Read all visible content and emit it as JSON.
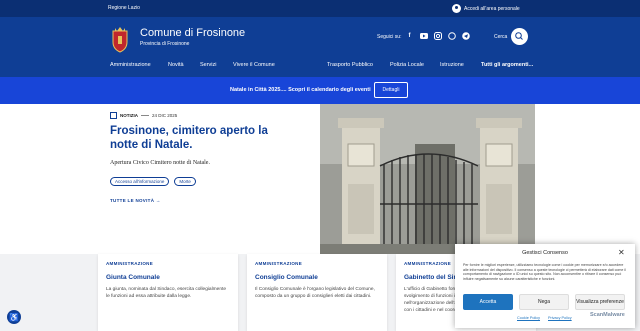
{
  "topbar": {
    "region": "Regione Lazio",
    "login": "Accedi all'area personale"
  },
  "header": {
    "title": "Comune di Frosinone",
    "subtitle": "Provincia di Frosinone",
    "social_label": "Seguici su:",
    "socials": [
      "facebook-icon",
      "youtube-icon",
      "instagram-icon",
      "whatsapp-icon",
      "telegram-icon"
    ],
    "search_label": "Cerca"
  },
  "nav": {
    "items": [
      "Amministrazione",
      "Novità",
      "Servizi",
      "Vivere il Comune"
    ],
    "secondary": [
      "Trasporto Pubblico",
      "Polizia Locale",
      "Istruzione"
    ],
    "all": "Tutti gli argomenti..."
  },
  "banner": {
    "text": "Natale in Città 2025.... Scopri il calendario degli eventi",
    "button": "Dettagli"
  },
  "article": {
    "category": "NOTIZIA",
    "date": "24 DIC 2025",
    "title": "Frosinone, cimitero aperto la notte di Natale.",
    "lede": "Apertura Civico Cimitero notte di Natale.",
    "tags": [
      "Accesso all'informazione",
      "Morte"
    ],
    "all_news": "TUTTE LE NOVITÀ"
  },
  "cards": [
    {
      "kicker": "AMMINISTRAZIONE",
      "title": "Giunta Comunale",
      "desc": "La giunta, nominata dal Sindaco, esercita collegialmente le funzioni ad essa attribuite dalla legge."
    },
    {
      "kicker": "AMMINISTRAZIONE",
      "title": "Consiglio Comunale",
      "desc": "Il Consiglio Comunale è l'organo legislativo del Comune, composto da un gruppo di consiglieri eletti dai cittadini."
    },
    {
      "kicker": "AMMINISTRAZIONE",
      "title": "Gabinetto del Sindaco",
      "desc": "L'ufficio di Gabinetto fornisce supporto al Sindaco nello svolgimento di funzioni istituzionali, coadiuvandolo nell'organizzazione dell'attività della Giunta, nei rapporti con i cittadini e nel coordinamento della Giunta."
    }
  ],
  "consent": {
    "title": "Gestisci Consenso",
    "body": "Per fornire le migliori esperienze, utilizziamo tecnologie come i cookie per memorizzare e/o accedere alle informazioni del dispositivo. Il consenso a queste tecnologie ci permetterà di elaborare dati come il comportamento di navigazione o ID unici su questo sito. Non acconsentire o ritirare il consenso può influire negativamente su alcune caratteristiche e funzioni.",
    "accept": "Accetta",
    "deny": "Nega",
    "prefs": "Visualizza preferenze",
    "cookie_policy": "Cookie Policy",
    "privacy_policy": "Privacy Policy",
    "watermark": "ScanMalware"
  },
  "colors": {
    "primary": "#0f3e95",
    "banner": "#1845d8",
    "topbar": "#0b2f73",
    "accept": "#1e73be"
  }
}
